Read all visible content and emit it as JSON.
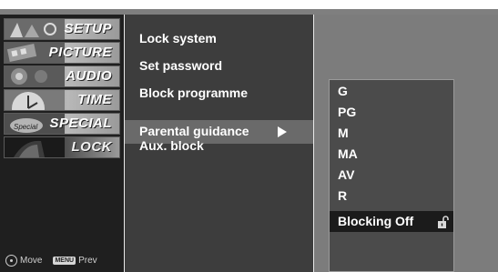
{
  "left_menu": {
    "tabs": [
      {
        "label": "SETUP",
        "icon": "setup-icon"
      },
      {
        "label": "PICTURE",
        "icon": "picture-icon"
      },
      {
        "label": "AUDIO",
        "icon": "audio-icon"
      },
      {
        "label": "TIME",
        "icon": "time-icon"
      },
      {
        "label": "SPECIAL",
        "icon": "special-icon"
      },
      {
        "label": "LOCK",
        "icon": "lock-tab-icon",
        "active": true
      }
    ],
    "legend": {
      "move": "Move",
      "menu_key": "MENU",
      "prev": "Prev"
    }
  },
  "lock_menu": {
    "items": [
      "Lock system",
      "Set password",
      "Block programme",
      "Parental guidance",
      "Aux. block"
    ],
    "selected": "Parental guidance"
  },
  "parental_options": {
    "items": [
      "G",
      "PG",
      "M",
      "MA",
      "AV",
      "R",
      "Blocking Off"
    ],
    "selected": "Blocking Off",
    "selected_icon": "unlock-icon"
  },
  "colors": {
    "left_panel": "#1f1f1f",
    "mid_panel": "#3d3d3d",
    "mid_highlight": "#6a6a6a",
    "right_panel": "#7c7c7c",
    "options_box": "#4b4b4b",
    "option_highlight": "#1b1b1b",
    "text": "#ffffff"
  }
}
